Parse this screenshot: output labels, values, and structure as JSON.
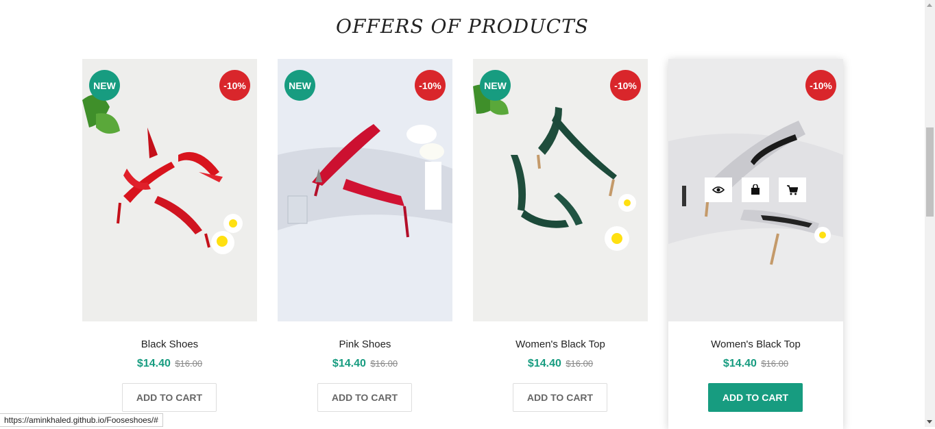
{
  "section": {
    "title": "OFFERS OF PRODUCTS"
  },
  "colors": {
    "accent": "#179c80",
    "discount": "#d9262b"
  },
  "products": [
    {
      "name": "Black Shoes",
      "price": "$14.40",
      "old_price": "$16.00",
      "badge_new": "NEW",
      "badge_discount": "-10%",
      "button": "ADD TO CART"
    },
    {
      "name": "Pink Shoes",
      "price": "$14.40",
      "old_price": "$16.00",
      "badge_new": "NEW",
      "badge_discount": "-10%",
      "button": "ADD TO CART"
    },
    {
      "name": "Women's Black Top",
      "price": "$14.40",
      "old_price": "$16.00",
      "badge_new": "NEW",
      "badge_discount": "-10%",
      "button": "ADD TO CART"
    },
    {
      "name": "Women's Black Top",
      "price": "$14.40",
      "old_price": "$16.00",
      "badge_discount": "-10%",
      "button": "ADD TO CART",
      "hover_actions": [
        "eye-icon",
        "shopping-bag-icon",
        "cart-icon"
      ]
    }
  ],
  "status_bar": {
    "url": "https://aminkhaled.github.io/Fooseshoes/#"
  }
}
